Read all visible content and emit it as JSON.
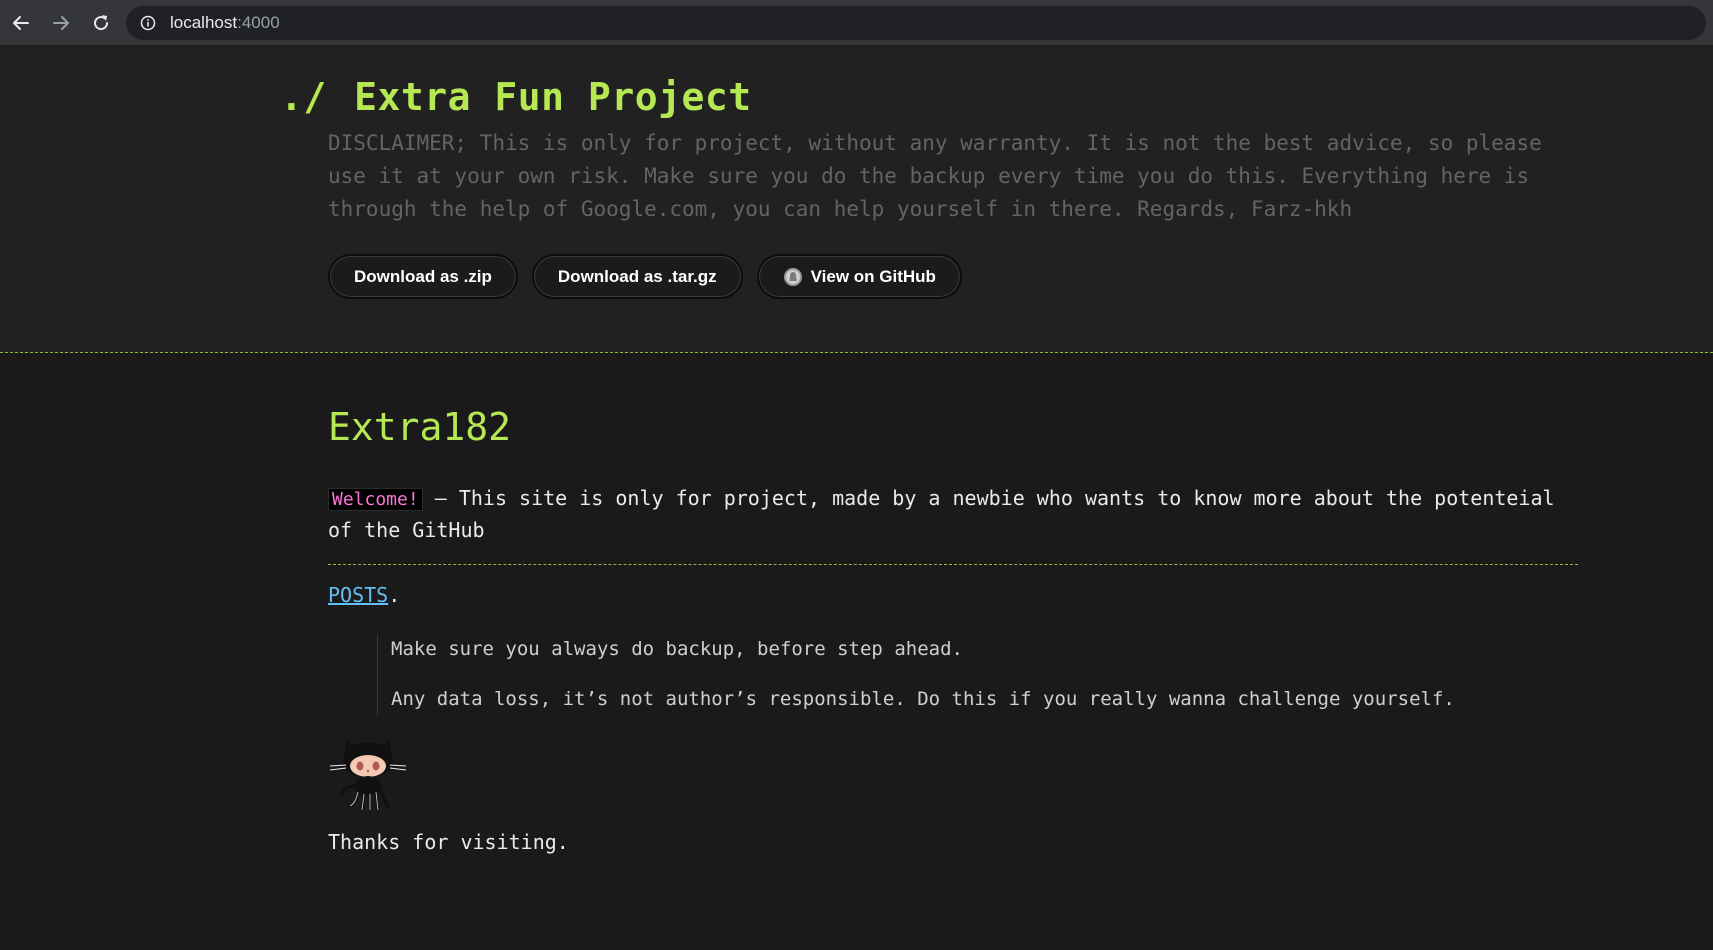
{
  "browser": {
    "url_host": "localhost",
    "url_port": ":4000"
  },
  "header": {
    "title_prefix": "./",
    "title": "Extra Fun Project",
    "disclaimer": "DISCLAIMER; This is only for project, without any warranty. It is not the best advice, so please use it at your own risk. Make sure you do the backup every time you do this. Everything here is through the help of Google.com, you can help yourself in there. Regards, Farz-hkh",
    "buttons": {
      "zip": "Download as .zip",
      "targz": "Download as .tar.gz",
      "github": "View on GitHub"
    }
  },
  "main": {
    "heading": "Extra182",
    "welcome_code": "Welcome!",
    "intro_text": " – This site is only for project, made by a newbie who wants to know more about the potenteial of the GitHub",
    "posts_link": "POSTS",
    "posts_suffix": ".",
    "quote_lines": [
      "Make sure you always do backup, before step ahead.",
      "Any data loss, it’s not author’s responsible. Do this if you really wanna challenge yourself."
    ],
    "thanks": "Thanks for visiting."
  },
  "icons": {
    "back": "arrow-left-icon",
    "forward": "arrow-right-icon",
    "reload": "reload-icon",
    "info": "info-icon",
    "github": "github-icon",
    "mascot": "octocat-icon"
  },
  "colors": {
    "accent_green": "#b5e853",
    "link_blue": "#63c0f5",
    "code_pink": "#fa75d7",
    "background": "#1a1a1a"
  }
}
